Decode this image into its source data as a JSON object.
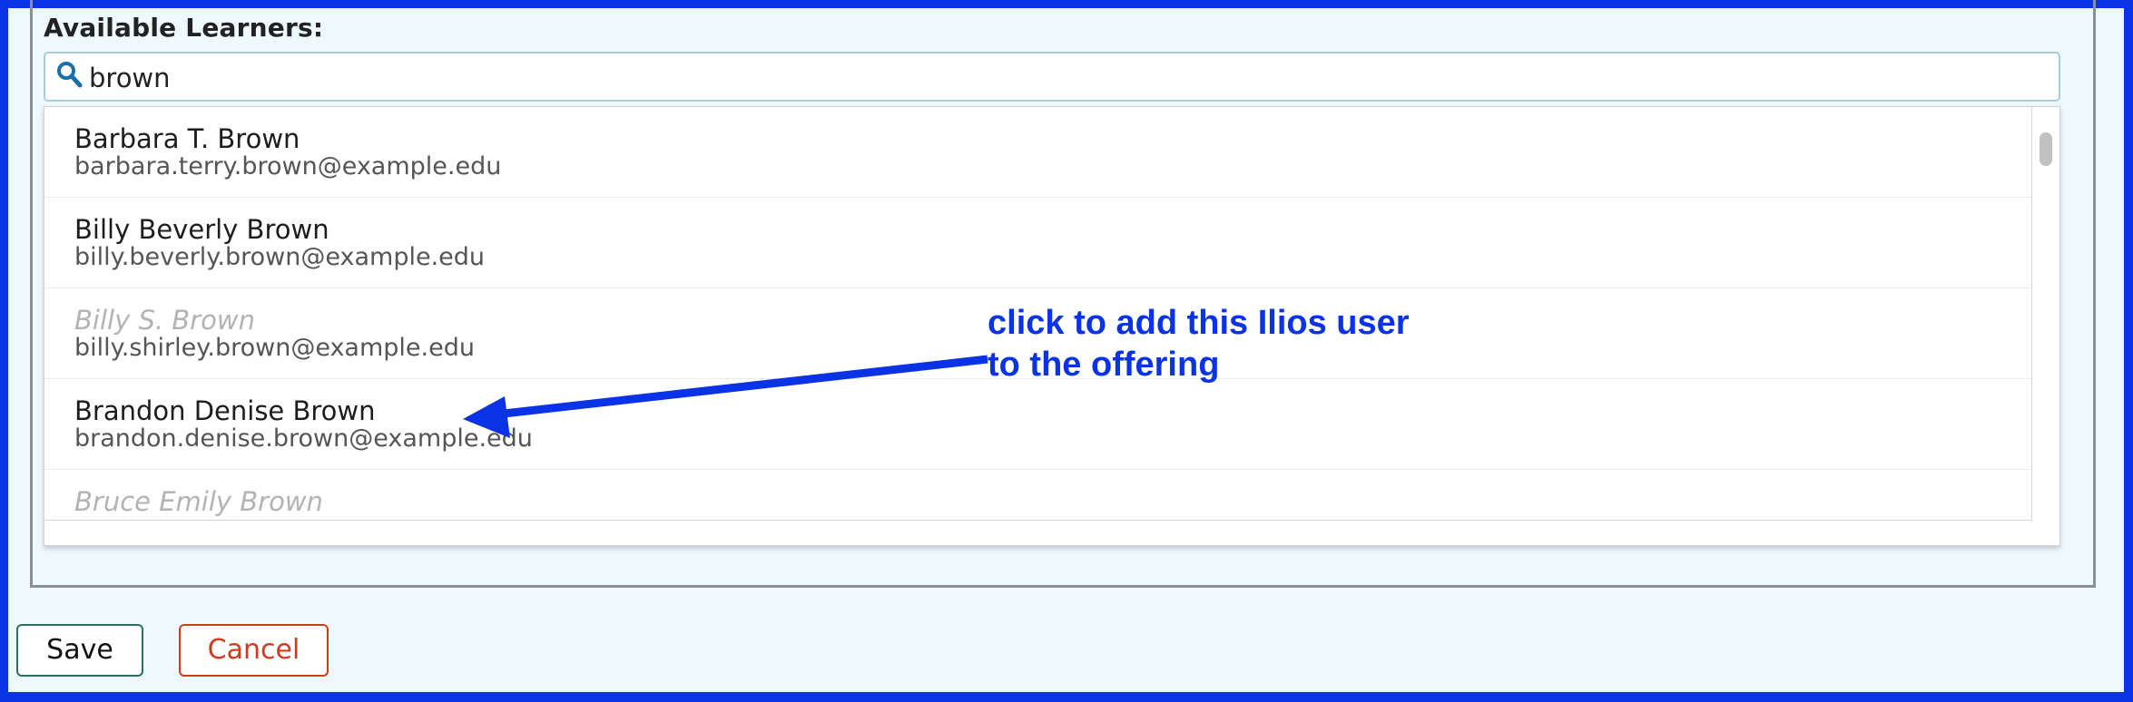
{
  "learners": {
    "label": "Available Learners:",
    "search": {
      "value": "brown",
      "placeholder": ""
    },
    "results": [
      {
        "name": "Barbara T. Brown",
        "email": "barbara.terry.brown@example.edu",
        "disabled": false
      },
      {
        "name": "Billy Beverly Brown",
        "email": "billy.beverly.brown@example.edu",
        "disabled": false
      },
      {
        "name": "Billy S. Brown",
        "email": "billy.shirley.brown@example.edu",
        "disabled": true
      },
      {
        "name": "Brandon Denise Brown",
        "email": "brandon.denise.brown@example.edu",
        "disabled": false
      },
      {
        "name": "Bruce Emily Brown",
        "email": "",
        "disabled": true
      }
    ]
  },
  "buttons": {
    "save": "Save",
    "cancel": "Cancel"
  },
  "annotation": {
    "text": "click to add this Ilios user\nto the offering"
  },
  "colors": {
    "accent": "#0a33e6",
    "cancel": "#d23a1e",
    "save_border": "#2e6d5f"
  },
  "icons": {
    "search": "search-icon"
  }
}
